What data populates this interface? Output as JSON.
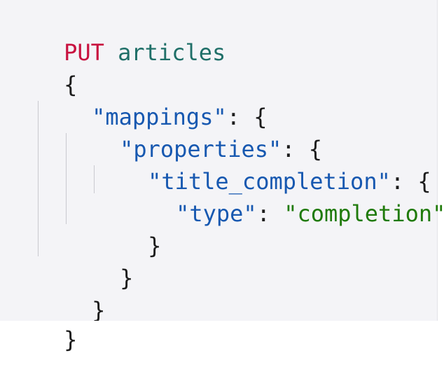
{
  "request": {
    "method": "PUT",
    "path": "articles"
  },
  "lines": [
    {
      "open_brace": "{"
    },
    {
      "key": "\"mappings\"",
      "sep": ": ",
      "brace": "{"
    },
    {
      "key": "\"properties\"",
      "sep": ": ",
      "brace": "{"
    },
    {
      "key": "\"title_completion\"",
      "sep": ": ",
      "brace": "{"
    },
    {
      "key": "\"type\"",
      "sep": ": ",
      "value": "\"completion\""
    },
    {
      "close": "}"
    },
    {
      "close": "}"
    },
    {
      "close": "}"
    },
    {
      "close": "}"
    }
  ],
  "colors": {
    "method": "#c8113f",
    "identifier": "#1f6f68",
    "key": "#1758b0",
    "string": "#1f7a0a",
    "background": "#f4f4f7"
  }
}
